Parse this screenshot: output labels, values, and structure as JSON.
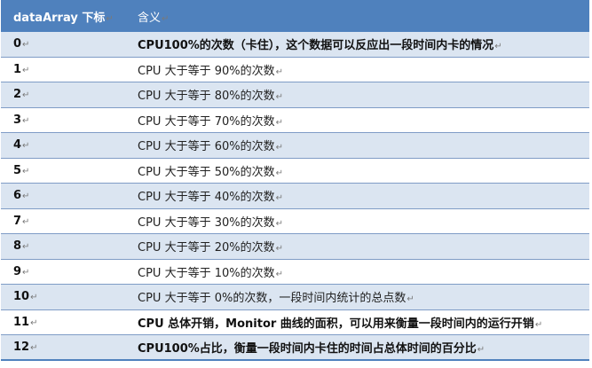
{
  "header": {
    "col1": "dataArray 下标",
    "col2": "含义"
  },
  "para_mark": "↵",
  "rows": [
    {
      "index": "0",
      "text": "CPU100%的次数（卡住），这个数据可以反应出一段时间内卡的情况",
      "bold": true
    },
    {
      "index": "1",
      "text": "CPU 大于等于 90%的次数",
      "bold": false
    },
    {
      "index": "2",
      "text": "CPU 大于等于 80%的次数",
      "bold": false
    },
    {
      "index": "3",
      "text": "CPU 大于等于 70%的次数",
      "bold": false
    },
    {
      "index": "4",
      "text": "CPU 大于等于 60%的次数",
      "bold": false
    },
    {
      "index": "5",
      "text": "CPU 大于等于 50%的次数",
      "bold": false
    },
    {
      "index": "6",
      "text": "CPU 大于等于 40%的次数",
      "bold": false
    },
    {
      "index": "7",
      "text": "CPU 大于等于 30%的次数",
      "bold": false
    },
    {
      "index": "8",
      "text": "CPU 大于等于 20%的次数",
      "bold": false
    },
    {
      "index": "9",
      "text": "CPU 大于等于 10%的次数",
      "bold": false
    },
    {
      "index": "10",
      "text": "CPU 大于等于 0%的次数，一段时间内统计的总点数",
      "bold": false
    },
    {
      "index": "11",
      "text": "CPU 总体开销，Monitor 曲线的面积，可以用来衡量一段时间内的运行开销",
      "bold": true
    },
    {
      "index": "12",
      "text": "CPU100%占比，衡量一段时间内卡住的时间占总体时间的百分比",
      "bold": true
    }
  ]
}
